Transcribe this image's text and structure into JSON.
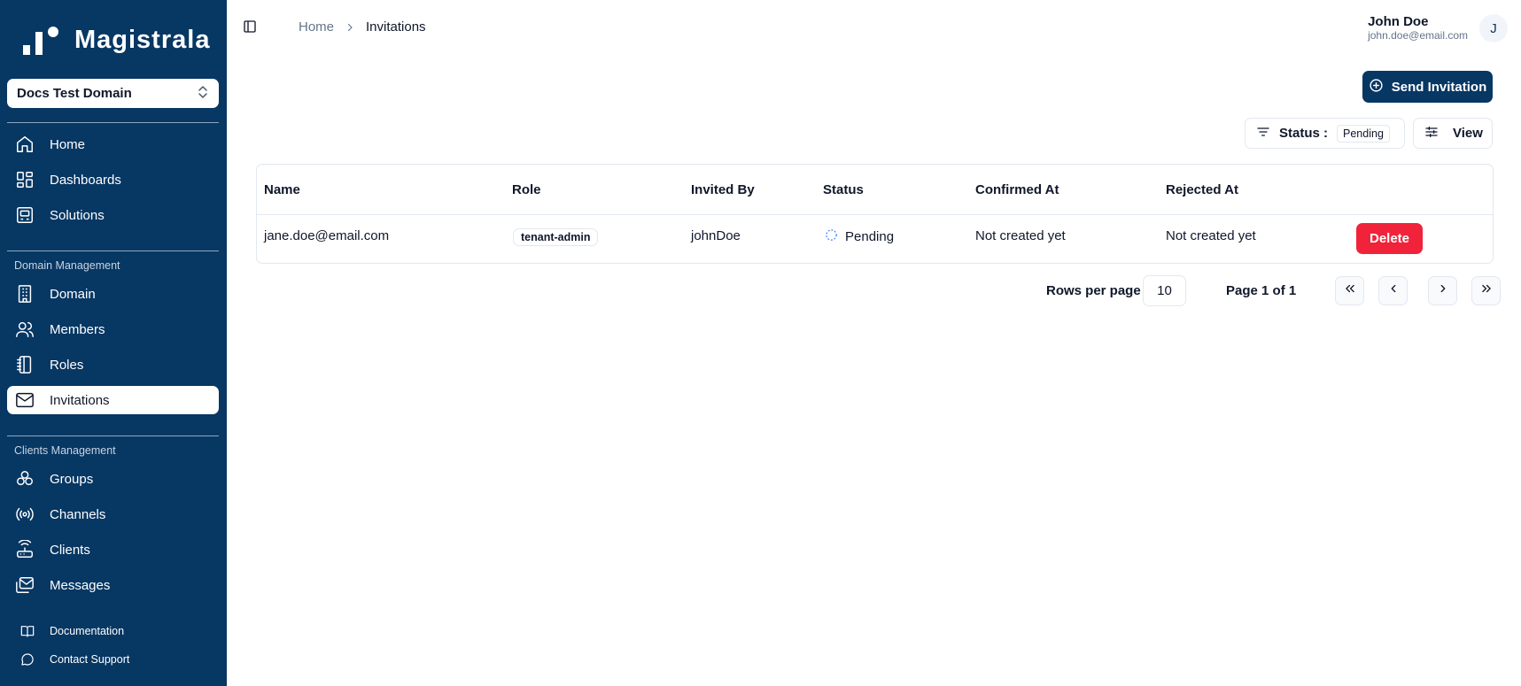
{
  "app": {
    "name": "Magistrala"
  },
  "sidebar": {
    "domain_selector": {
      "value": "Docs Test Domain"
    },
    "main_items": [
      {
        "label": "Home",
        "icon": "home-icon"
      },
      {
        "label": "Dashboards",
        "icon": "dashboard-icon"
      },
      {
        "label": "Solutions",
        "icon": "solutions-icon"
      }
    ],
    "domain_section_label": "Domain Management",
    "domain_items": [
      {
        "label": "Domain",
        "icon": "building-icon"
      },
      {
        "label": "Members",
        "icon": "users-icon"
      },
      {
        "label": "Roles",
        "icon": "notebook-icon"
      },
      {
        "label": "Invitations",
        "icon": "mail-icon",
        "active": true
      }
    ],
    "clients_section_label": "Clients Management",
    "clients_items": [
      {
        "label": "Groups",
        "icon": "groups-icon"
      },
      {
        "label": "Channels",
        "icon": "radio-icon"
      },
      {
        "label": "Clients",
        "icon": "router-icon"
      },
      {
        "label": "Messages",
        "icon": "messages-icon"
      }
    ],
    "footer_items": [
      {
        "label": "Documentation",
        "icon": "book-icon"
      },
      {
        "label": "Contact Support",
        "icon": "chat-icon"
      }
    ]
  },
  "header": {
    "breadcrumb": {
      "home": "Home",
      "current": "Invitations"
    },
    "user": {
      "name": "John Doe",
      "email": "john.doe@email.com",
      "initial": "J"
    }
  },
  "toolbar": {
    "send_invitation_label": "Send Invitation",
    "status_filter_label": "Status :",
    "status_filter_value": "Pending",
    "view_label": "View"
  },
  "table": {
    "columns": [
      "Name",
      "Role",
      "Invited By",
      "Status",
      "Confirmed At",
      "Rejected At"
    ],
    "rows": [
      {
        "name": "jane.doe@email.com",
        "role": "tenant-admin",
        "invited_by": "johnDoe",
        "status": "Pending",
        "confirmed_at": "Not created yet",
        "rejected_at": "Not created yet",
        "action": "Delete"
      }
    ]
  },
  "pagination": {
    "rows_per_page_label": "Rows per page",
    "rows_per_page_value": "10",
    "page_label": "Page 1 of 1"
  },
  "colors": {
    "sidebar_bg": "#073763",
    "primary": "#073763",
    "danger": "#f0233b",
    "border": "#e2e8f0"
  }
}
